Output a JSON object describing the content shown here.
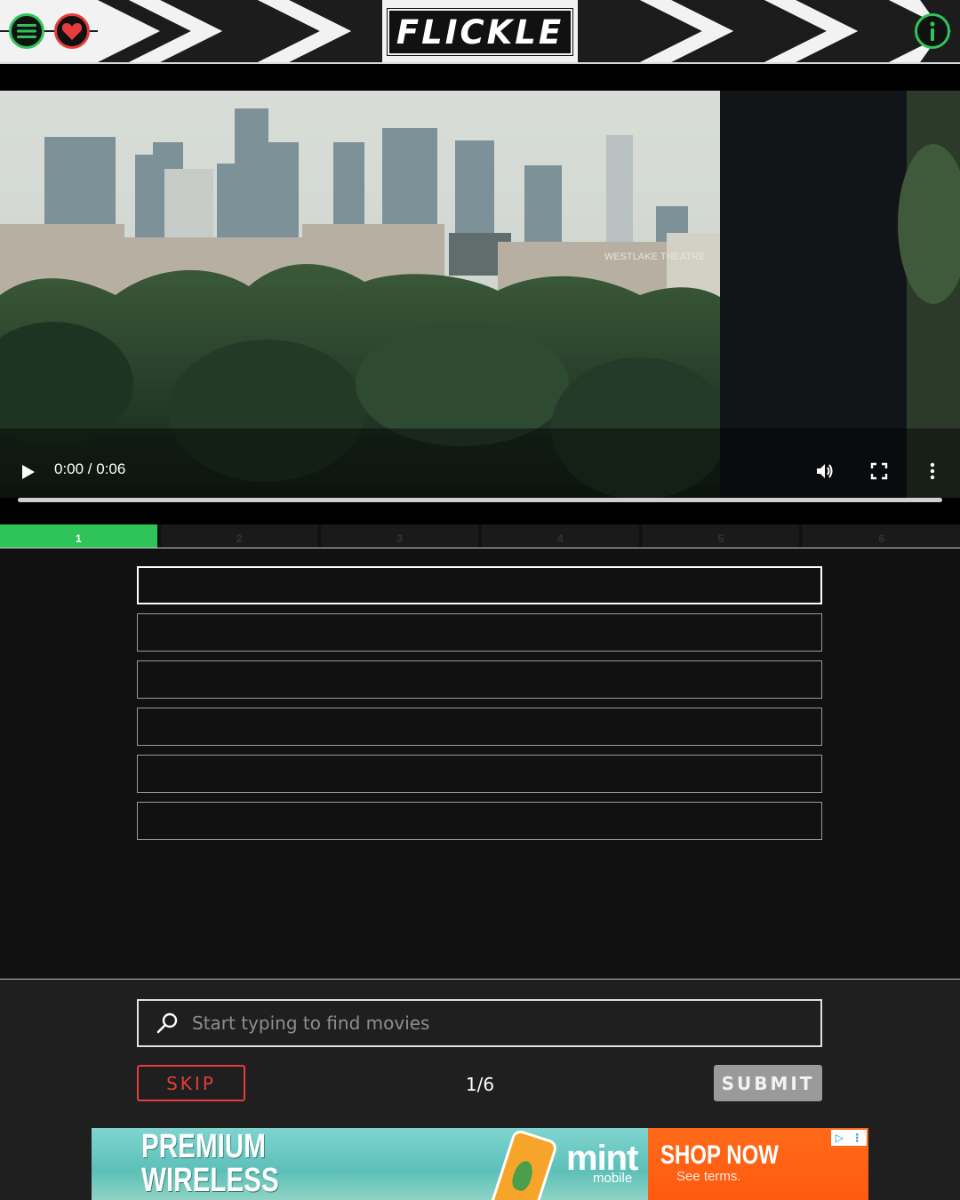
{
  "header": {
    "logo_text": "FLICKLE",
    "menu_icon": "hamburger-menu-icon",
    "favorite_icon": "heart-icon",
    "info_icon": "info-icon",
    "accent_green": "#2ec45a",
    "accent_red": "#e83b3b"
  },
  "video": {
    "time_display": "0:00 / 0:06",
    "controls": [
      "play-icon",
      "volume-icon",
      "fullscreen-icon",
      "more-options-icon"
    ],
    "scene_sign": "WESTLAKE THEATRE"
  },
  "steps": [
    {
      "label": "1",
      "active": true
    },
    {
      "label": "2",
      "active": false
    },
    {
      "label": "3",
      "active": false
    },
    {
      "label": "4",
      "active": false
    },
    {
      "label": "5",
      "active": false
    },
    {
      "label": "6",
      "active": false
    }
  ],
  "guesses": [
    "",
    "",
    "",
    "",
    "",
    ""
  ],
  "search": {
    "placeholder": "Start typing to find movies",
    "icon": "search-icon"
  },
  "actions": {
    "skip_label": "SKIP",
    "counter": "1/6",
    "submit_label": "SUBMIT"
  },
  "ad": {
    "headline_line1": "PREMIUM",
    "headline_line2": "WIRELESS",
    "brand": "mint",
    "brand_sub": "mobile",
    "cta": "SHOP NOW",
    "terms": "See terms."
  }
}
